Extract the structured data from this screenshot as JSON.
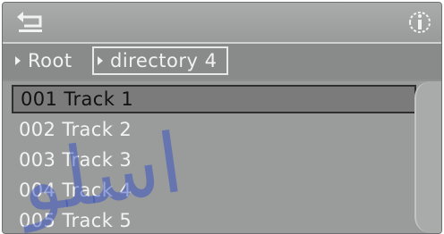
{
  "topbar": {
    "back_icon": "back-arrow-icon",
    "info_icon": "info-icon"
  },
  "breadcrumb": {
    "root_label": "Root",
    "current_label": "directory 4"
  },
  "tracks": [
    {
      "label": "001 Track 1",
      "selected": true
    },
    {
      "label": "002 Track 2",
      "selected": false
    },
    {
      "label": "003 Track 3",
      "selected": false
    },
    {
      "label": "004 Track 4",
      "selected": false
    },
    {
      "label": "005 Track 5",
      "selected": false
    }
  ],
  "watermark": {
    "text": "اسلو"
  },
  "colors": {
    "screen_bg": "#8e8f8f",
    "text": "#f3f3f3",
    "selected_text": "#111111",
    "watermark": "#2846c8"
  }
}
